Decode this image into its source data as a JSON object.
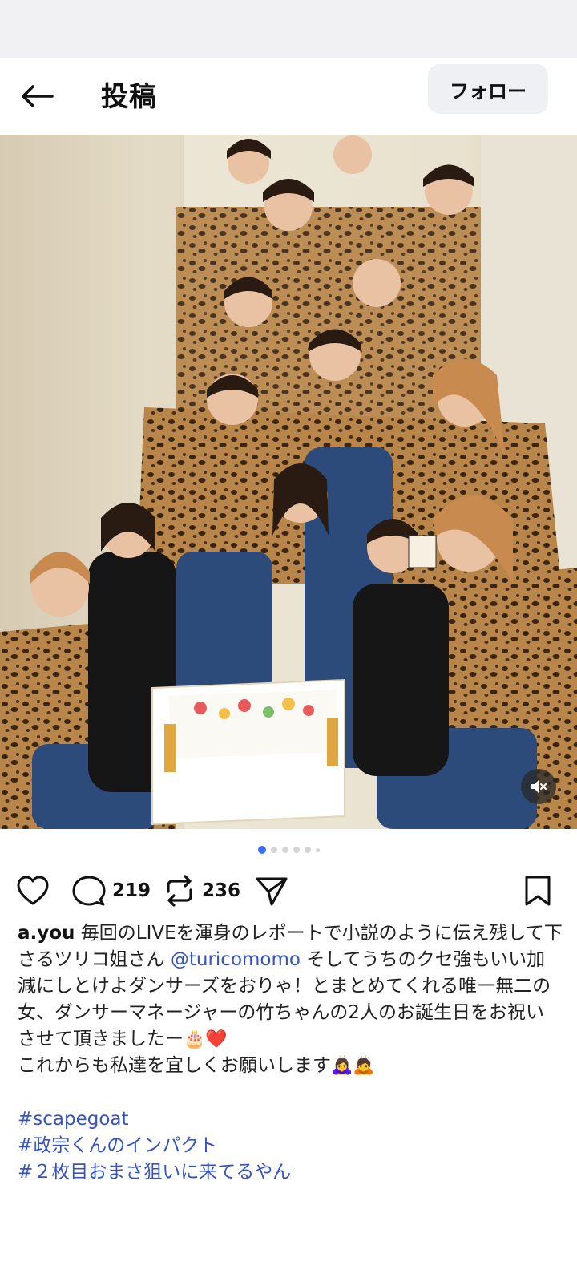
{
  "header": {
    "title": "投稿",
    "follow_label": "フォロー"
  },
  "media": {
    "carousel_total": 6,
    "carousel_active_index": 0,
    "muted": true
  },
  "actions": {
    "comments_count": "219",
    "reposts_count": "236"
  },
  "caption": {
    "username": "a.you",
    "text_part1": "毎回のLIVEを渾身のレポートで小説のように伝え残して下さるツリコ姐さん",
    "mention": "@turicomomo",
    "text_part2": "そしてうちのクセ強もいい加減にしとけよダンサーズをおりゃ！とまとめてくれる唯一無二の女、ダンサーマネージャーの竹ちゃんの2人のお誕生日をお祝いさせて頂きましたー",
    "line2": "これからも私達を宜しくお願いします",
    "emoji_cake": "🎂",
    "emoji_heart": "❤️",
    "emoji_bow1": "🙇‍♀️",
    "emoji_bow2": "🙇"
  },
  "hashtags": [
    "#scapegoat",
    "#政宗くんのインパクト",
    "#２枚目おまさ狙いに来てるやん"
  ],
  "colors": {
    "link": "#3552c9",
    "accent_dot": "#3b6df2",
    "follow_bg": "#eef0f3"
  }
}
